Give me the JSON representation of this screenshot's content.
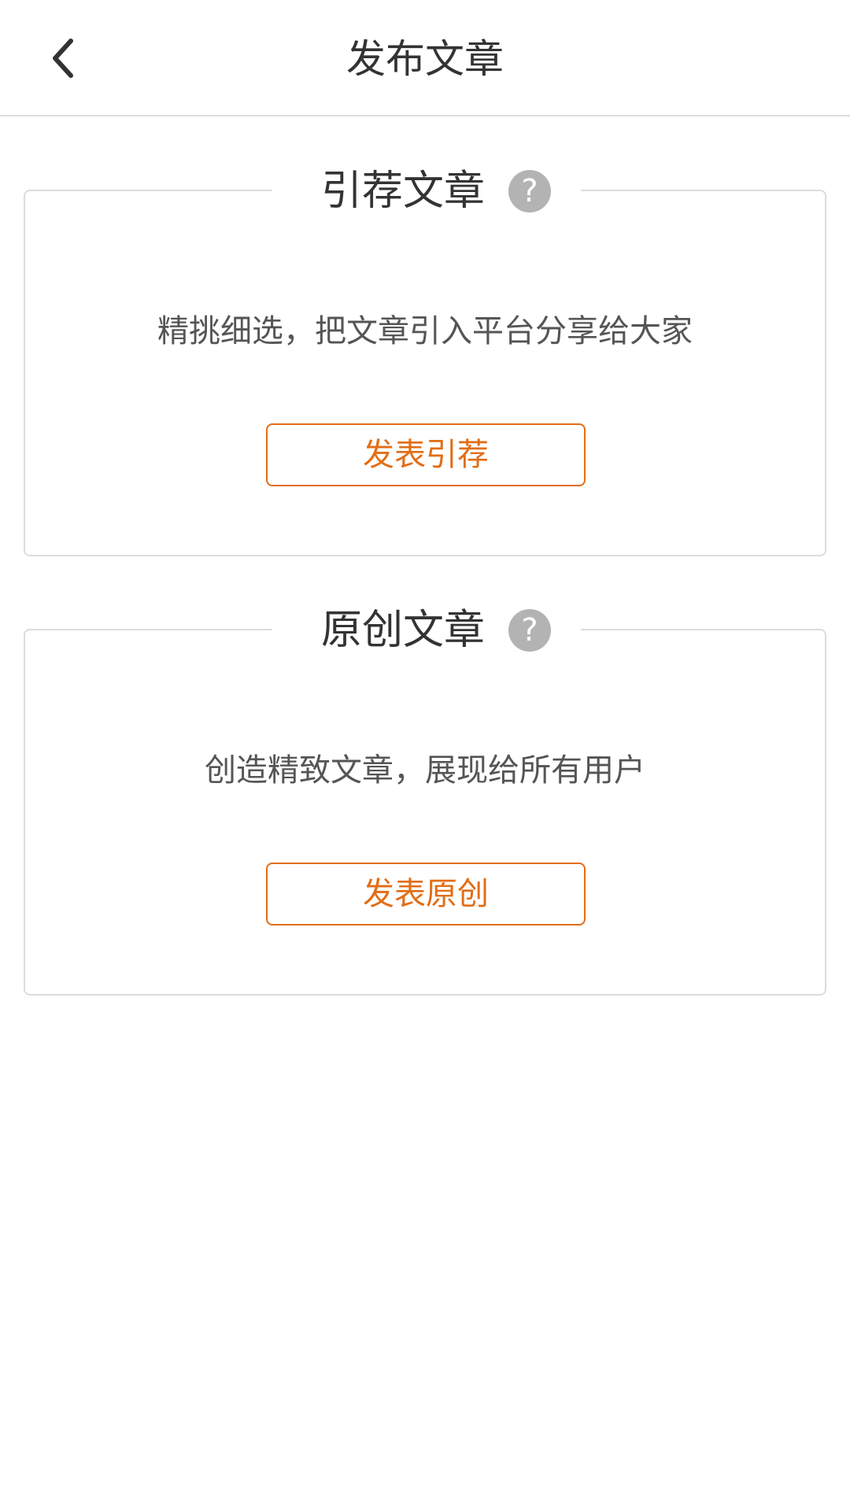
{
  "header": {
    "title": "发布文章",
    "back_icon": "chevron-left-icon"
  },
  "cards": [
    {
      "title": "引荐文章",
      "help_icon": "?",
      "description": "精挑细选，把文章引入平台分享给大家",
      "button_label": "发表引荐"
    },
    {
      "title": "原创文章",
      "help_icon": "?",
      "description": "创造精致文章，展现给所有用户",
      "button_label": "发表原创"
    }
  ],
  "colors": {
    "accent": "#e26d16",
    "border": "#dcdcdc",
    "help_icon_bg": "#b3b3b3",
    "text": "#333333"
  }
}
